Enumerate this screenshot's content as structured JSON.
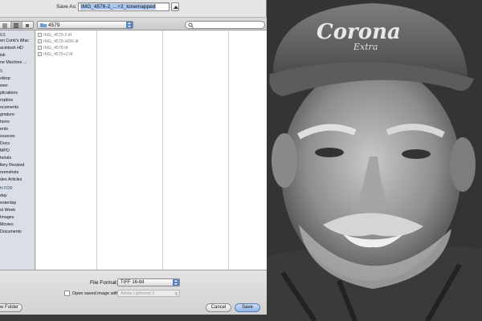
{
  "save_dialog": {
    "save_as_label": "Save As:",
    "filename_value": "IMG_4576-2_...+2_tonemapped",
    "current_folder": "4579",
    "search_placeholder": ""
  },
  "sidebar": {
    "groups": [
      {
        "heading": "ES",
        "items": [
          "en Conti's iMac",
          "acintosh HD",
          "isk",
          "ne Machine ..."
        ]
      },
      {
        "heading": "S",
        "items": [
          "sktop",
          "wen",
          "plications",
          "ropbox",
          "ocuments",
          "gnature",
          "tures",
          "ents",
          "sources",
          "Docs",
          "MPD",
          "torials",
          "llery Resized",
          "reenshots",
          "deo Articles"
        ]
      },
      {
        "heading": "H FOR",
        "items": [
          "day",
          "esterday",
          "st Week",
          "Images",
          "Movies",
          "Documents"
        ]
      }
    ]
  },
  "files": [
    "IMG_4579-2.tif",
    "IMG_4579-HDR.tif",
    "IMG_4579.tif",
    "IMG_4579+2.tif"
  ],
  "format": {
    "label": "File Format:",
    "value": "TIFF 16-bit"
  },
  "open_with": {
    "label": "Open saved image with:",
    "value": "Adobe Lightroom 3",
    "checked": false
  },
  "buttons": {
    "new_folder": "w Folder",
    "cancel": "Cancel",
    "save": "Save"
  },
  "photo": {
    "cap_brand": "Corona",
    "cap_sub": "Extra"
  }
}
